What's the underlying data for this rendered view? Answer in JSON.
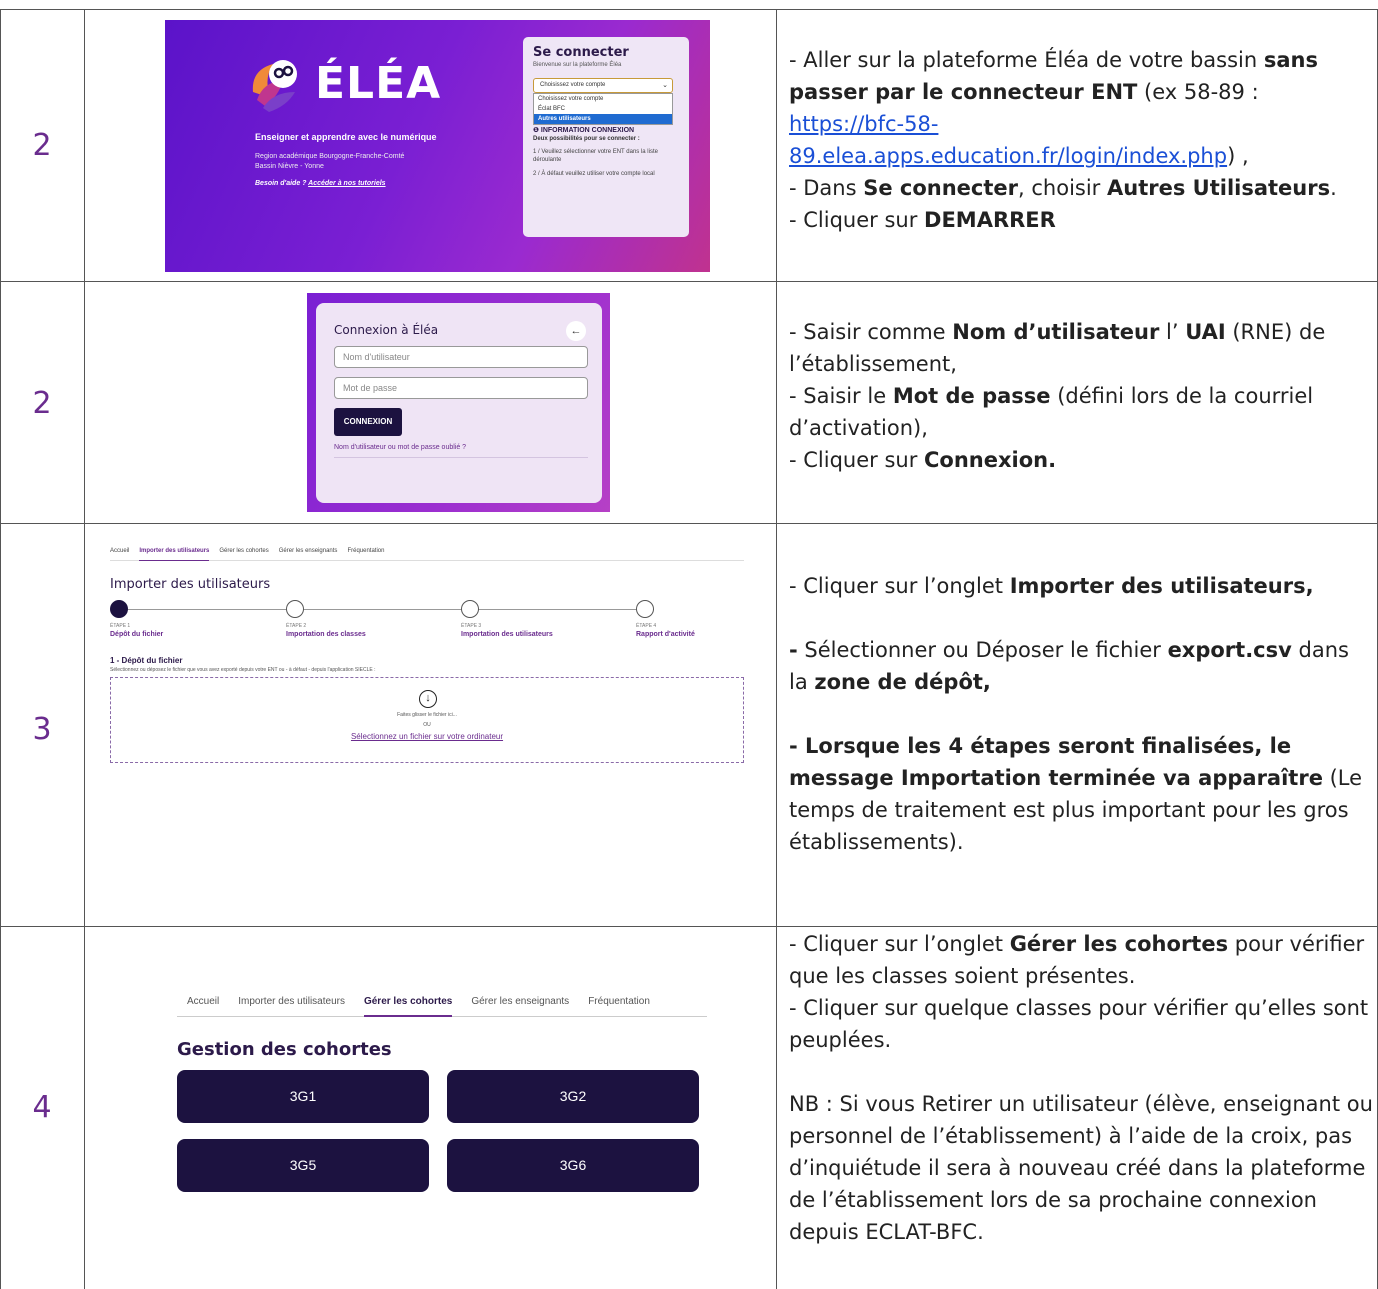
{
  "rows": [
    {
      "num": "2"
    },
    {
      "num": "2"
    },
    {
      "num": "3"
    },
    {
      "num": "4"
    }
  ],
  "shot1": {
    "logo": "ÉLÉA",
    "tagline": "Enseigner et apprendre avec le numérique",
    "region1": "Region académique Bourgogne-Franche-Comté",
    "region2": "Bassin Nièvre - Yonne",
    "help_prefix": "Besoin d'aide ? ",
    "help_link": "Accéder à nos tutoriels",
    "card_title": "Se connecter",
    "welcome": "Bienvenue sur la plateforme Éléa",
    "select_value": "Choisissez votre compte",
    "options": [
      "Choisissez votre compte",
      "Éclat BFC",
      "Autres utilisateurs"
    ],
    "info_title": "INFORMATION CONNEXION",
    "info_sub": "Deux possibilités pour se connecter :",
    "info_1": "1 / Veuillez sélectionner votre ENT dans la liste déroulante",
    "info_2": "2 / À défaut veuillez utiliser votre compte local"
  },
  "shot2": {
    "title": "Connexion à Éléa",
    "back": "←",
    "username_placeholder": "Nom d'utilisateur",
    "password_placeholder": "Mot de passe",
    "button": "CONNEXION",
    "forgot": "Nom d'utilisateur ou mot de passe oublié ?"
  },
  "shot3": {
    "tabs": [
      "Accueil",
      "Importer des utilisateurs",
      "Gérer les cohortes",
      "Gérer les enseignants",
      "Fréquentation"
    ],
    "title": "Importer des utilisateurs",
    "steps": [
      {
        "label": "ÉTAPE 1",
        "name": "Dépôt du fichier"
      },
      {
        "label": "ÉTAPE 2",
        "name": "Importation des classes"
      },
      {
        "label": "ÉTAPE 3",
        "name": "Importation des utilisateurs"
      },
      {
        "label": "ÉTAPE 4",
        "name": "Rapport d'activité"
      }
    ],
    "section_title": "1 - Dépôt du fichier",
    "section_desc": "Sélectionnez ou déposez le fichier que vous avez exporté depuis votre ENT ou - à défaut - depuis l'application SIECLE :",
    "drop_text": "Faites glisser le fichier ici...",
    "or": "OU",
    "select_link": "Sélectionnez un fichier sur votre ordinateur"
  },
  "shot4": {
    "tabs": [
      "Accueil",
      "Importer des utilisateurs",
      "Gérer les cohortes",
      "Gérer les enseignants",
      "Fréquentation"
    ],
    "title": "Gestion des cohortes",
    "cohorts": [
      "3G1",
      "3G2",
      "3G5",
      "3G6"
    ]
  },
  "instr1": {
    "a": "- Aller sur la plateforme Éléa de votre bassin ",
    "b": "sans passer par le connecteur ENT",
    "c": " (ex 58-89 : ",
    "link": "https://bfc-58-89.elea.apps.education.fr/login/index.php",
    "d": ") ,",
    "e": "- Dans ",
    "f": "Se connecter",
    "g": ", choisir ",
    "h": "Autres Utilisateurs",
    "i": ".",
    "j": "- Cliquer sur ",
    "k": "DEMARRER"
  },
  "instr2": {
    "a": "- Saisir comme ",
    "b": "Nom d’utilisateur",
    "c": " l’ ",
    "d": "UAI",
    "e": " (RNE) de l’établissement,",
    "f": "- Saisir le ",
    "g": "Mot de passe",
    "h": " (défini lors de la courriel d’activation),",
    "i": "- Cliquer sur ",
    "j": "Connexion."
  },
  "instr3": {
    "a": "- Cliquer sur l’onglet ",
    "b": "Importer des utilisateurs,",
    "c": "-",
    "d": " Sélectionner ou Déposer le fichier ",
    "e": "export.csv",
    "f": " dans la ",
    "g": "zone de dépôt,",
    "h": "- Lorsque les 4 étapes seront finalisées, le message Importation terminée  va apparaître",
    "i": " (Le temps de traitement est plus important pour les gros établissements)."
  },
  "instr4": {
    "a": "- Cliquer sur l’onglet ",
    "b": "Gérer les cohortes",
    "c": " pour vérifier que les classes soient présentes.",
    "d": "- Cliquer sur quelque classes pour vérifier qu’elles sont peuplées.",
    "e": "NB : Si vous Retirer un utilisateur (élève, enseignant ou personnel de l’établissement) à l’aide de la croix, pas d’inquiétude il sera à nouveau créé dans la plateforme de l’établissement lors de sa prochaine connexion depuis ECLAT-BFC."
  }
}
